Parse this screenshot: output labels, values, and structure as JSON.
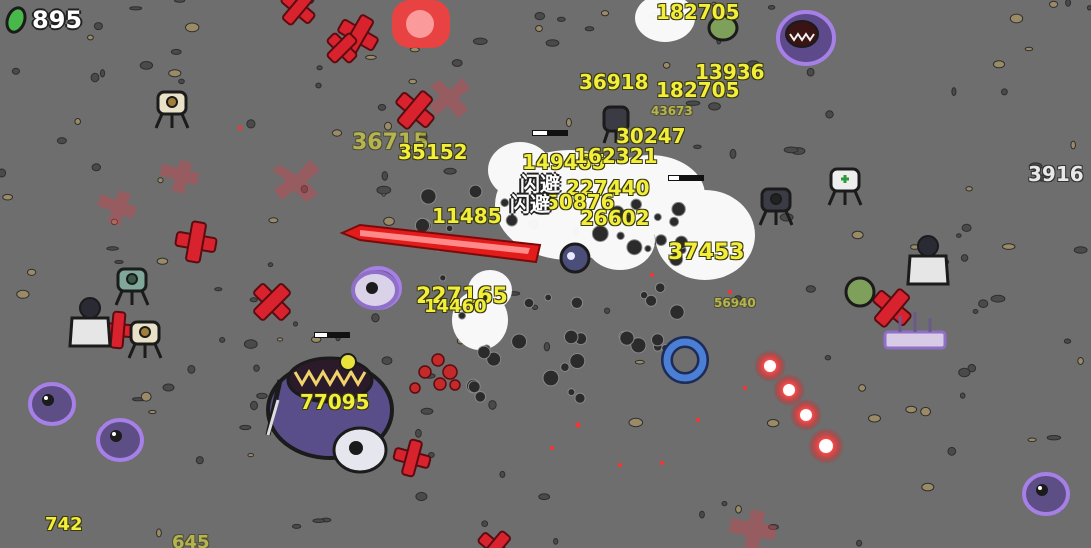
{
  "hud": {
    "coins": "895",
    "coin_icon": "green-gem-icon"
  },
  "damage_numbers": [
    "182705",
    "36918",
    "182705",
    "13936",
    "43673",
    "30247",
    "36715",
    "35152",
    "149465",
    "162321",
    "227440",
    "50876",
    "11485",
    "26602",
    "37453",
    "227165",
    "56940",
    "3916",
    "14460",
    "77095",
    "742",
    "645"
  ],
  "status_text": {
    "dodge_1": "闪避",
    "dodge_2": "闪避"
  },
  "colors": {
    "ground": "#6e6e6e",
    "damage_text": "#f2ee3a",
    "health_cross": "#d8232f",
    "enemy_purple": "#8f6fc7",
    "projectile_red": "#ff2a2a"
  }
}
